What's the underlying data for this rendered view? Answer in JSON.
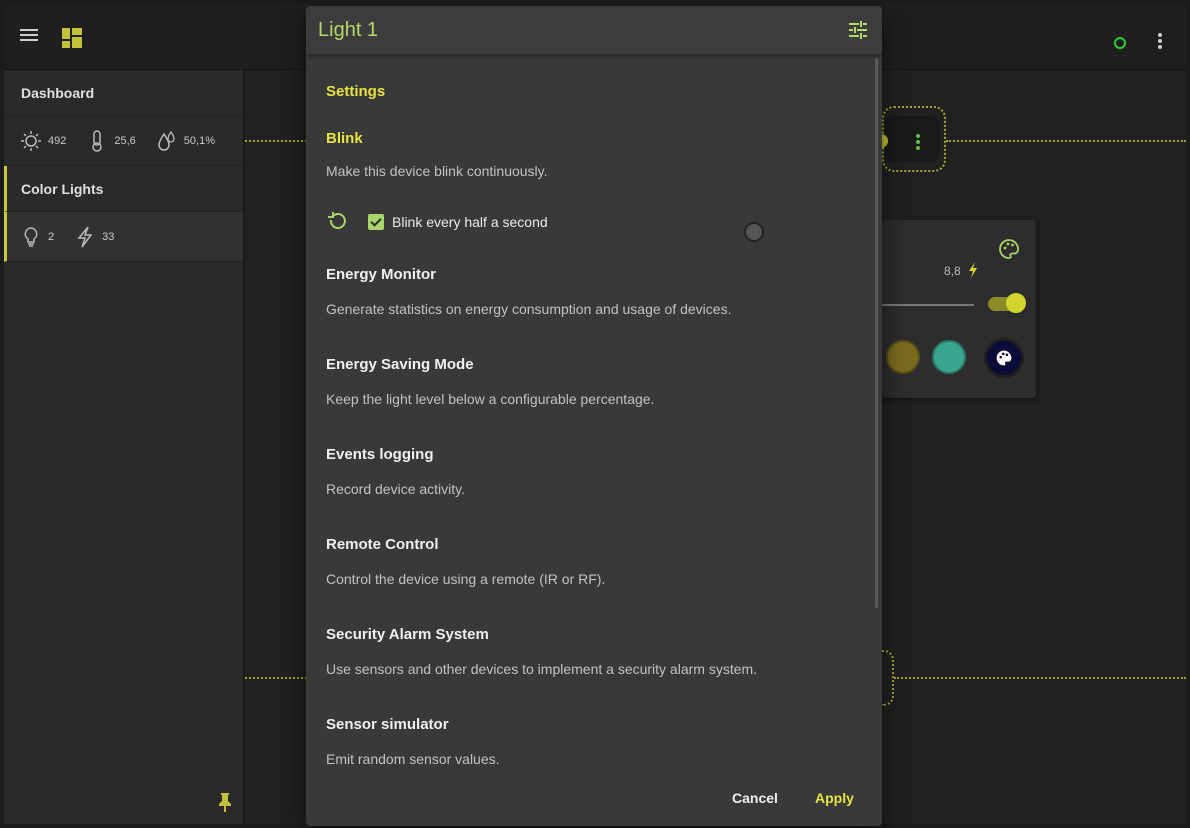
{
  "appbar": {
    "menu_icon": "hamburger-menu-icon",
    "dashboard_icon": "dashboard-grid-icon",
    "status_color": "#2ecc40",
    "more_icon": "more-vert-icon"
  },
  "sidebar": {
    "sections": [
      {
        "label": "Dashboard",
        "stats": [
          {
            "icon": "sun-icon",
            "value": "492"
          },
          {
            "icon": "thermometer-icon",
            "value": "25,6"
          },
          {
            "icon": "humidity-icon",
            "value": "50,1%"
          }
        ]
      },
      {
        "label": "Color Lights",
        "stats": [
          {
            "icon": "lightbulb-icon",
            "value": "2"
          },
          {
            "icon": "power-bolt-icon",
            "value": "33"
          }
        ]
      }
    ],
    "pin_icon": "pin-icon"
  },
  "background_card": {
    "power_value": "8,8",
    "swatches": [
      "#7a6a1e",
      "#3aa68e",
      "#0c0c3a"
    ],
    "accent": "#d4d42e"
  },
  "dialog": {
    "title": "Light 1",
    "tune_icon": "tune-icon",
    "settings_heading": "Settings",
    "plugins": [
      {
        "name": "Blink",
        "description": "Make this device blink continuously."
      },
      {
        "name": "Energy Monitor",
        "description": "Generate statistics on energy consumption and usage of devices."
      },
      {
        "name": "Energy Saving Mode",
        "description": "Keep the light level below a configurable percentage."
      },
      {
        "name": "Events logging",
        "description": "Record device activity."
      },
      {
        "name": "Remote Control",
        "description": "Control the device using a remote (IR or RF)."
      },
      {
        "name": "Security Alarm System",
        "description": "Use sensors and other devices to implement a security alarm system."
      },
      {
        "name": "Sensor simulator",
        "description": "Emit random sensor values."
      }
    ],
    "blink_option": {
      "label": "Blink every half a second",
      "checked": true
    },
    "cancel_label": "Cancel",
    "apply_label": "Apply"
  },
  "colors": {
    "accent_yellow": "#e5e542",
    "accent_green": "#b5d96a",
    "dialog_bg": "#393939"
  }
}
